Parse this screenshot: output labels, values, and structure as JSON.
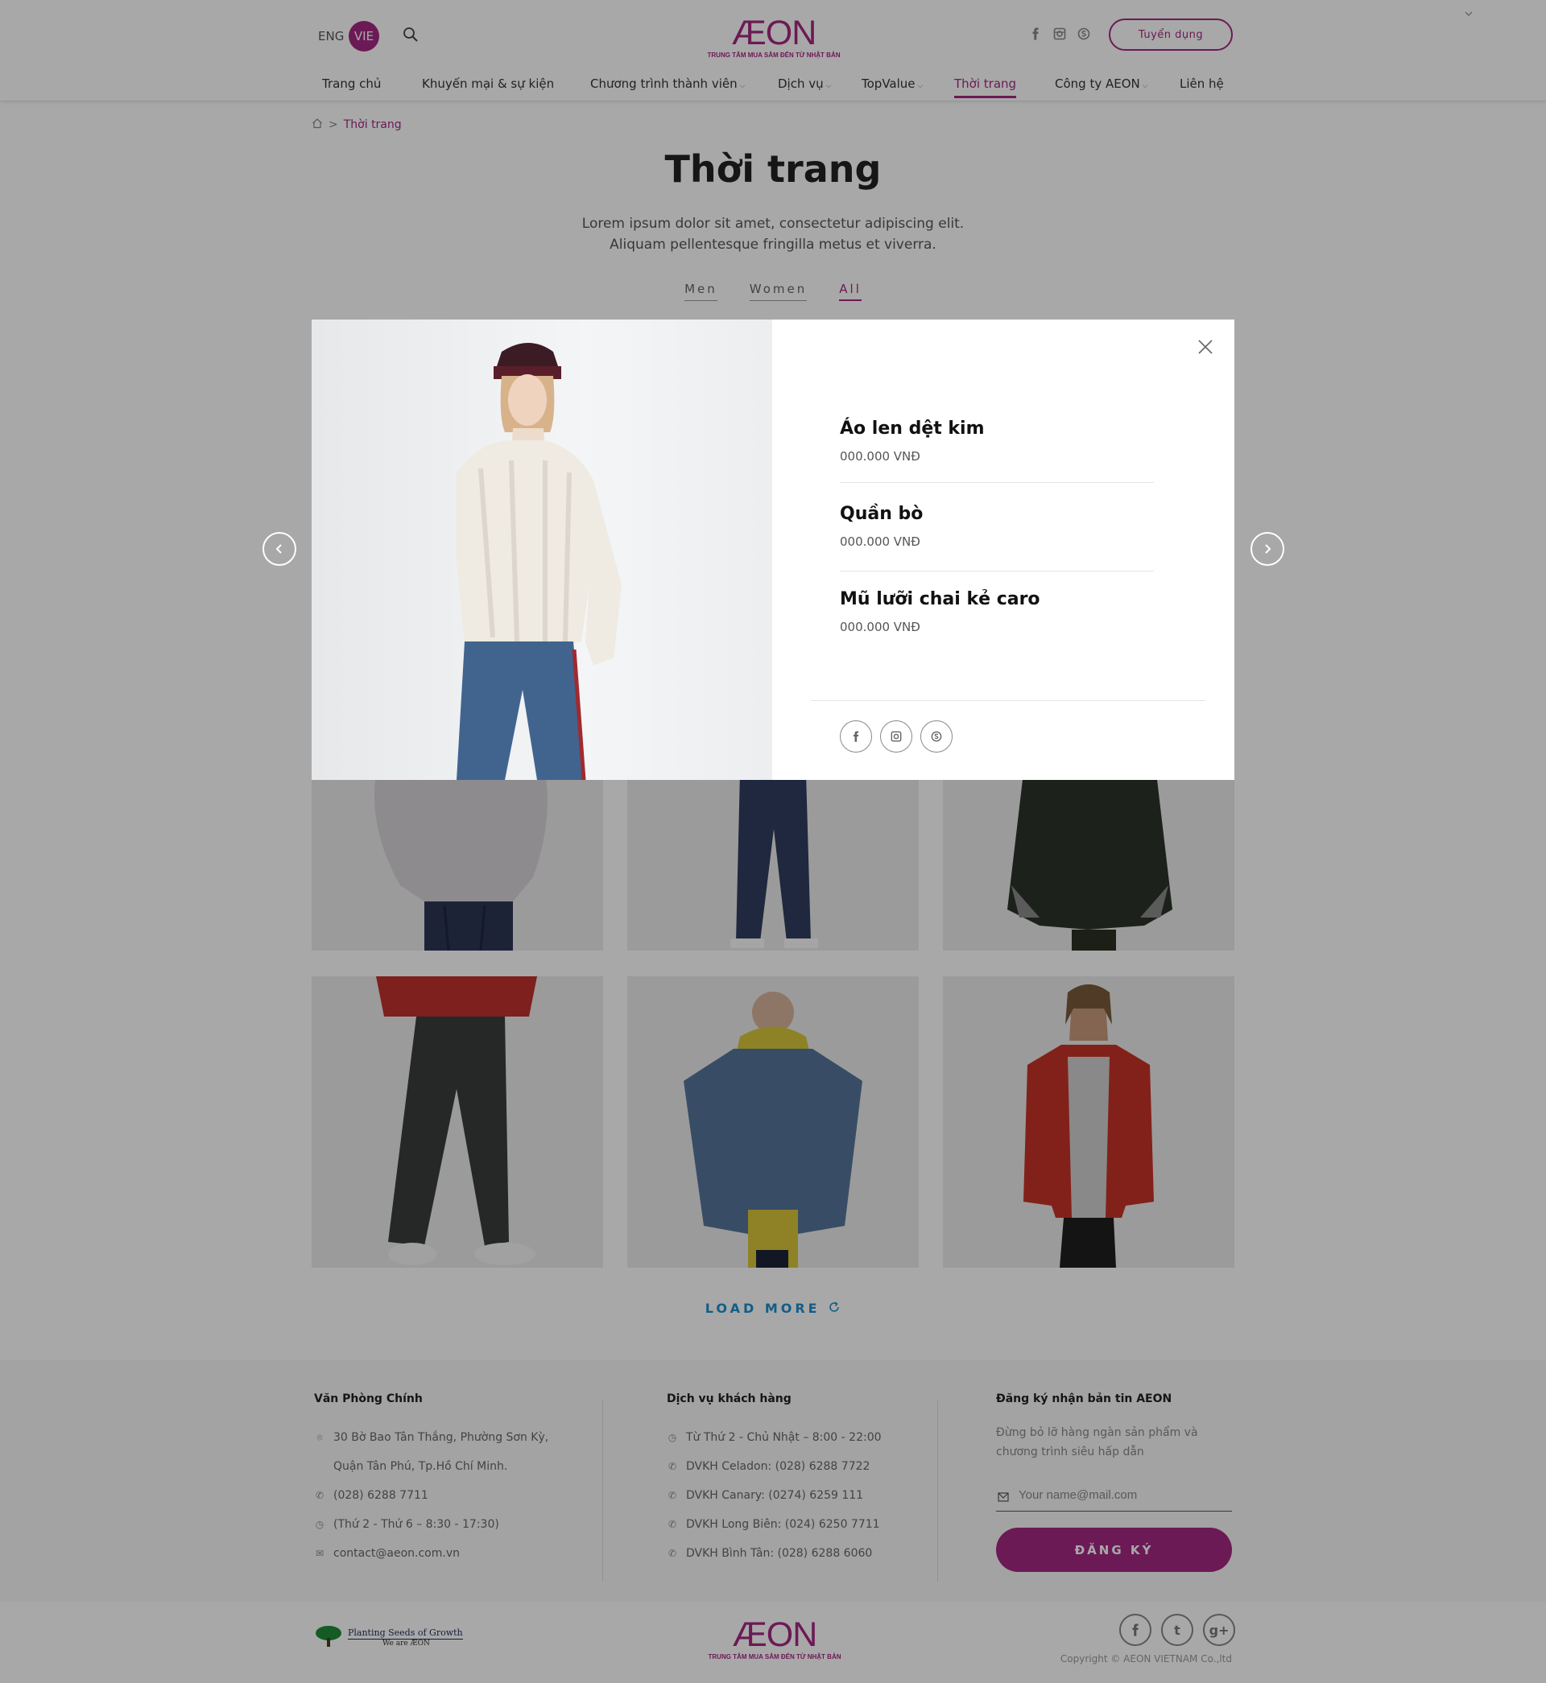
{
  "header": {
    "lang_eng": "ENG",
    "lang_vie": "VIE",
    "logo_word": "ÆON",
    "logo_tag": "TRUNG TÂM MUA SẮM ĐẾN TỪ NHẬT BẢN",
    "recruit_label": "Tuyển dụng",
    "nav": [
      {
        "label": "Trang chủ"
      },
      {
        "label": "Khuyến mại & sự kiện"
      },
      {
        "label": "Chương trình thành viên",
        "has_dropdown": true
      },
      {
        "label": "Dịch vụ",
        "has_dropdown": true
      },
      {
        "label": "TopValue",
        "has_dropdown": true
      },
      {
        "label": "Thời trang",
        "active": true
      },
      {
        "label": "Công ty AEON",
        "has_dropdown": true
      },
      {
        "label": "Liên hệ"
      }
    ]
  },
  "breadcrumb": {
    "separator": ">",
    "current": "Thời trang"
  },
  "page": {
    "title": "Thời trang",
    "description": "Lorem ipsum dolor sit amet, consectetur adipiscing elit. Aliquam pellentesque fringilla metus et viverra.",
    "filters": [
      {
        "label": "Men"
      },
      {
        "label": "Women"
      },
      {
        "label": "All",
        "active": true
      }
    ],
    "load_more": "LOAD MORE"
  },
  "modal": {
    "items": [
      {
        "name": "Áo len dệt kim",
        "price": "000.000 VNĐ"
      },
      {
        "name": "Quần bò",
        "price": "000.000 VNĐ"
      },
      {
        "name": "Mũ lưỡi chai kẻ caro",
        "price": "000.000 VNĐ"
      }
    ]
  },
  "footer": {
    "office": {
      "title": "Văn Phòng Chính",
      "address_line1": "30 Bờ Bao Tân Thắng, Phường Sơn Kỳ,",
      "address_line2": "Quận Tân Phú, Tp.Hồ Chí Minh.",
      "phone": "(028) 6288 7711",
      "hours": "(Thứ 2 - Thứ 6 – 8:30 - 17:30)",
      "email": "contact@aeon.com.vn"
    },
    "service": {
      "title": "Dịch vụ khách hàng",
      "hours": "Từ Thứ 2 - Chủ Nhật – 8:00 - 22:00",
      "lines": [
        "DVKH Celadon: (028) 6288 7722",
        "DVKH Canary: (0274) 6259 111",
        "DVKH Long Biên: (024) 6250 7711",
        "DVKH Bình Tân: (028) 6288 6060"
      ]
    },
    "newsletter": {
      "title": "Đăng ký nhận bản tin AEON",
      "description": "Đừng bỏ lỡ hàng ngàn sản phẩm và chương trình siêu hấp dẫn",
      "email_placeholder": "Your name@mail.com",
      "subscribe_label": "ĐĂNG KÝ"
    },
    "seeds_title": "Planting Seeds of Growth",
    "seeds_sub": "We are ÆON",
    "logo_word": "ÆON",
    "logo_tag": "TRUNG TÂM MUA SẮM ĐẾN TỪ NHẬT BẢN",
    "social_twitter": "t",
    "social_gplus": "g+",
    "copyright": "Copyright © AEON VIETNAM Co.,ltd"
  },
  "colors": {
    "brand": "#a42882",
    "link_blue": "#1a8fcf",
    "overlay": "rgba(0,0,0,0.34)"
  },
  "icons": {
    "header": [
      "search-icon",
      "facebook-icon",
      "instagram-icon",
      "skype-icon"
    ],
    "modal": [
      "close-icon",
      "chevron-left-icon",
      "chevron-right-icon",
      "facebook-icon",
      "instagram-icon",
      "skype-icon"
    ]
  }
}
